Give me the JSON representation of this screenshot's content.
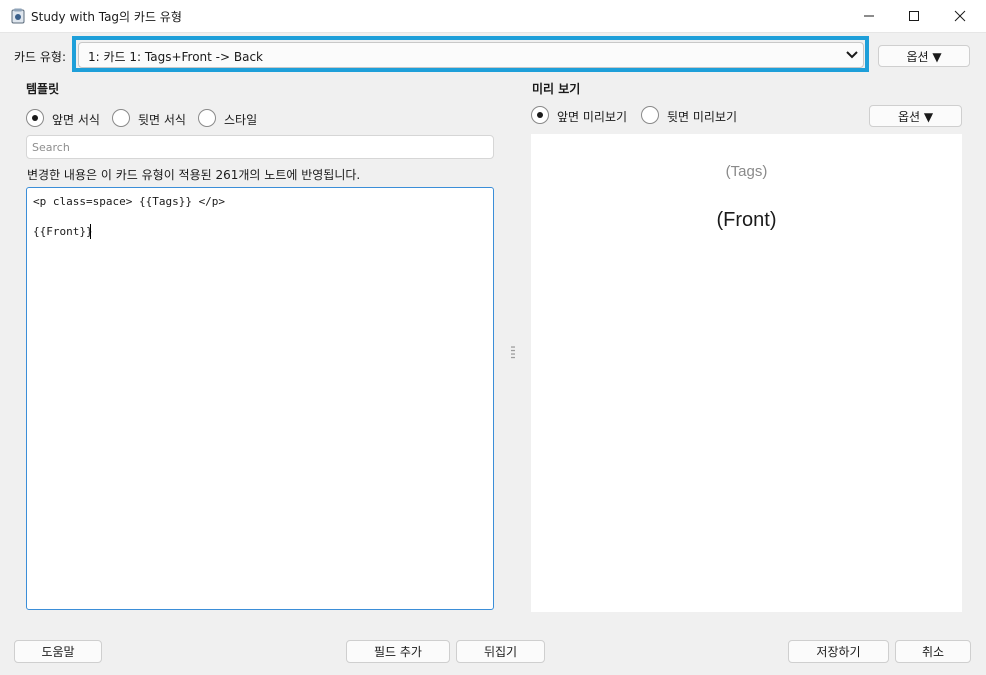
{
  "window": {
    "title": "Study with Tag의 카드 유형",
    "icons": [
      "app-icon",
      "minimize-icon",
      "maximize-icon",
      "close-icon"
    ]
  },
  "card_type": {
    "label": "카드 유형:",
    "selected": "1: 카드 1: Tags+Front -> Back",
    "options_button": "옵션 ▼"
  },
  "template": {
    "heading": "템플릿",
    "radios": [
      {
        "label": "앞면 서식",
        "selected": true
      },
      {
        "label": "뒷면 서식",
        "selected": false
      },
      {
        "label": "스타일",
        "selected": false
      }
    ],
    "search_placeholder": "Search",
    "info_text": "변경한 내용은 이 카드 유형이 적용된 261개의 노트에 반영됩니다.",
    "editor_lines": [
      "<p class=space> {{Tags}} </p>",
      "",
      "{{Front}}"
    ]
  },
  "preview": {
    "heading": "미리 보기",
    "radios": [
      {
        "label": "앞면 미리보기",
        "selected": true
      },
      {
        "label": "뒷면 미리보기",
        "selected": false
      }
    ],
    "options_button": "옵션 ▼",
    "tags_text": "(Tags)",
    "front_text": "(Front)"
  },
  "footer": {
    "help": "도움말",
    "add_field": "필드 추가",
    "flip": "뒤집기",
    "save": "저장하기",
    "cancel": "취소"
  },
  "colors": {
    "highlight": "#1e9fd9",
    "editor_focus": "#3b8ed8"
  }
}
